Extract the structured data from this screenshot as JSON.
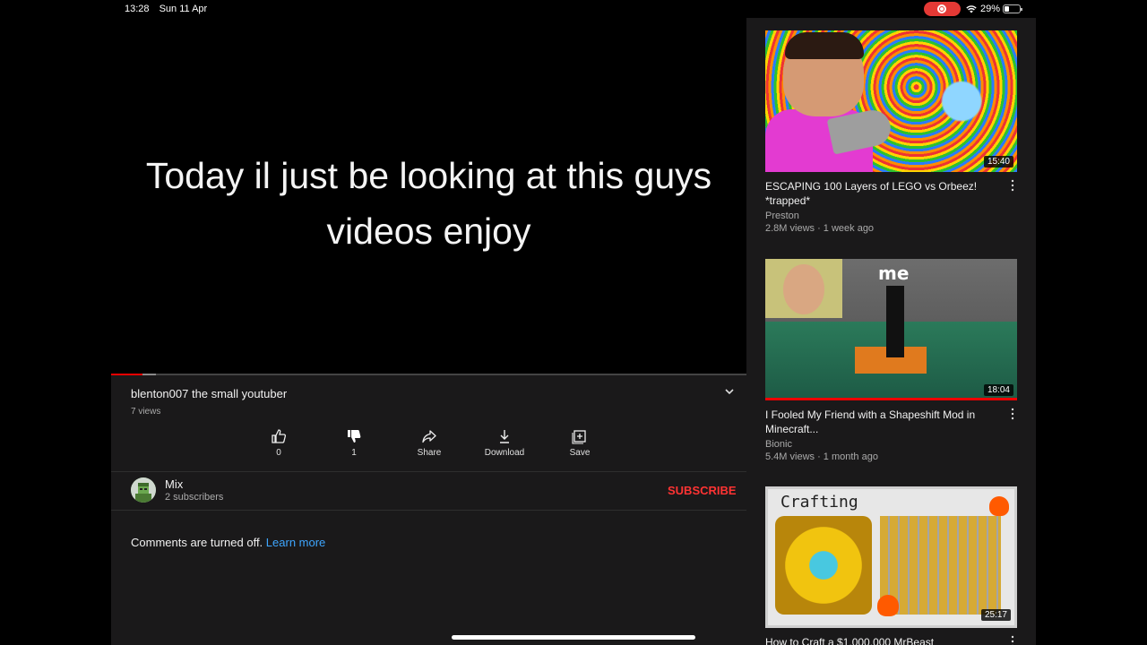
{
  "status_bar": {
    "time": "13:28",
    "date": "Sun 11 Apr",
    "battery": "29%",
    "icons": [
      "screen-record-icon",
      "wifi-icon",
      "battery-icon"
    ],
    "record_color": "#e53935"
  },
  "video": {
    "caption_line1": "Today il just be looking at this guys",
    "caption_line2": "videos enjoy",
    "progress_fraction": 0.05,
    "buffered_fraction": 0.02
  },
  "info": {
    "title": "blenton007 the small youtuber",
    "views": "7 views",
    "actions": {
      "like": {
        "label": "0",
        "icon": "thumbs-up-icon"
      },
      "dislike": {
        "label": "1",
        "icon": "thumbs-down-icon"
      },
      "share": {
        "label": "Share",
        "icon": "share-icon"
      },
      "download": {
        "label": "Download",
        "icon": "download-icon"
      },
      "save": {
        "label": "Save",
        "icon": "add-to-playlist-icon"
      }
    },
    "channel": {
      "name": "Mix",
      "subscribers": "2 subscribers",
      "subscribe_label": "SUBSCRIBE",
      "subscribe_color": "#ff3333"
    },
    "comments": {
      "text": "Comments are turned off.",
      "link": "Learn more",
      "link_color": "#3ea6ff"
    }
  },
  "recommendations": [
    {
      "title": "ESCAPING 100 Layers of LEGO vs Orbeez! *trapped*",
      "channel": "Preston",
      "meta": "2.8M views · 1 week ago",
      "duration": "15:40"
    },
    {
      "title": "I Fooled My Friend with a Shapeshift Mod in Minecraft...",
      "channel": "Bionic",
      "meta": "5.4M views · 1 month ago",
      "duration": "18:04",
      "thumb_text": "me"
    },
    {
      "title": "How to Craft a $1,000,000 MrBeast",
      "channel": "",
      "meta": "",
      "duration": "25:17",
      "thumb_text": "Crafting"
    }
  ]
}
